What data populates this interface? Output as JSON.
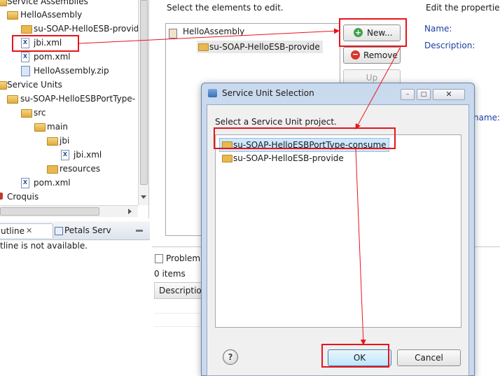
{
  "tree": {
    "items": [
      {
        "label": "Service Assemblies"
      },
      {
        "label": "HelloAssembly"
      },
      {
        "label": "su-SOAP-HelloESB-provide"
      },
      {
        "label": "jbi.xml"
      },
      {
        "label": "pom.xml"
      },
      {
        "label": "HelloAssembly.zip"
      },
      {
        "label": "Service Units"
      },
      {
        "label": "su-SOAP-HelloESBPortType-"
      },
      {
        "label": "src"
      },
      {
        "label": "main"
      },
      {
        "label": "jbi"
      },
      {
        "label": "jbi.xml"
      },
      {
        "label": "resources"
      },
      {
        "label": "pom.xml"
      },
      {
        "label": "Croquis"
      }
    ],
    "xml_icon_glyph": "X"
  },
  "outline": {
    "tab_outline": "utline",
    "tab_petals": "Petals Serv",
    "message": "tline is not available."
  },
  "editor": {
    "prompt": "Select the elements to edit.",
    "properties_heading": "Edit the properties",
    "name_label": "Name:",
    "description_label": "Description:",
    "right_name_label": "name:",
    "list_items": [
      "HelloAssembly",
      "su-SOAP-HelloESB-provide"
    ],
    "new_button": "New...",
    "remove_button": "Remove",
    "up_button": "Up"
  },
  "problems": {
    "tab_label": "Problem",
    "count": "0 items",
    "column_header": "Descriptio"
  },
  "dialog": {
    "title": "Service Unit Selection",
    "instruction": "Select a Service Unit project.",
    "items": [
      "su-SOAP-HelloESBPortType-consume",
      "su-SOAP-HelloESB-provide"
    ],
    "ok_button": "OK",
    "cancel_button": "Cancel",
    "help_glyph": "?"
  },
  "colors": {
    "annotation_red": "#e8141b",
    "selection_blue": "#cde8ff",
    "label_blue": "#1b3fa0"
  }
}
